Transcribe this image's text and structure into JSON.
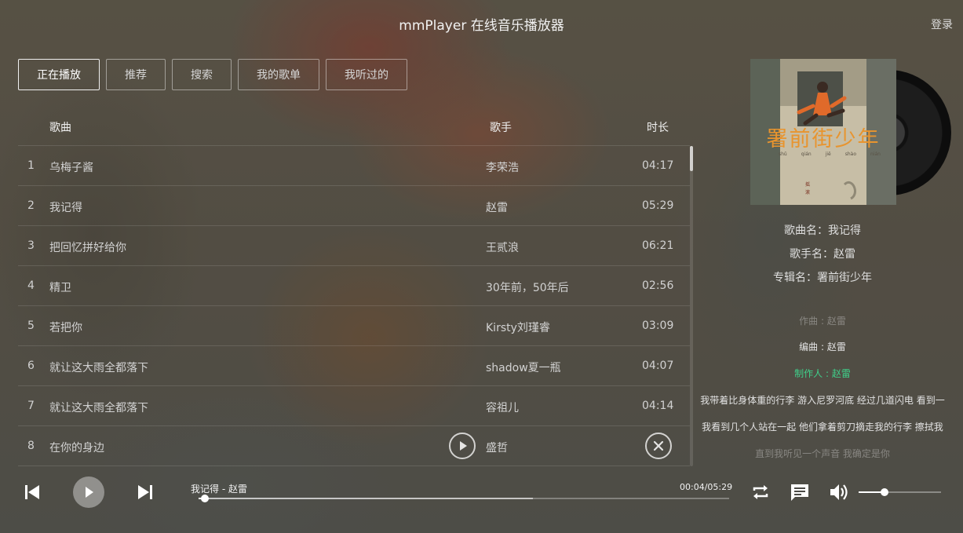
{
  "app": {
    "title": "mmPlayer 在线音乐播放器",
    "login_label": "登录"
  },
  "tabs": [
    {
      "label": "正在播放",
      "active": true
    },
    {
      "label": "推荐",
      "active": false
    },
    {
      "label": "搜索",
      "active": false
    },
    {
      "label": "我的歌单",
      "active": false
    },
    {
      "label": "我听过的",
      "active": false
    }
  ],
  "list": {
    "headers": {
      "song": "歌曲",
      "singer": "歌手",
      "duration": "时长"
    },
    "rows": [
      {
        "num": "1",
        "name": "乌梅子酱",
        "singer": "李荣浩",
        "duration": "04:17"
      },
      {
        "num": "2",
        "name": "我记得",
        "singer": "赵雷",
        "duration": "05:29"
      },
      {
        "num": "3",
        "name": "把回忆拼好给你",
        "singer": "王贰浪",
        "duration": "06:21"
      },
      {
        "num": "4",
        "name": "精卫",
        "singer": "30年前，50年后",
        "duration": "02:56"
      },
      {
        "num": "5",
        "name": "若把你",
        "singer": "Kirsty刘瑾睿",
        "duration": "03:09"
      },
      {
        "num": "6",
        "name": "就让这大雨全都落下",
        "singer": "shadow夏一瓶",
        "duration": "04:07"
      },
      {
        "num": "7",
        "name": "就让这大雨全都落下",
        "singer": "容祖儿",
        "duration": "04:14"
      },
      {
        "num": "8",
        "name": "在你的身边",
        "singer": "盛哲",
        "duration": ""
      }
    ],
    "hovered_row_index": 7
  },
  "album": {
    "cover_title_art": "署前街少年",
    "cover_pinyin": [
      "shǔ",
      "qián",
      "jiē",
      "shào",
      "nián"
    ]
  },
  "song_info": {
    "song_name": "歌曲名：我记得",
    "singer_name": "歌手名：赵雷",
    "album_name": "专辑名：署前街少年"
  },
  "lyrics": [
    {
      "text": "作曲 : 赵雷",
      "state": "dim"
    },
    {
      "text": "编曲 : 赵雷",
      "state": "normal"
    },
    {
      "text": "制作人 : 赵雷",
      "state": "current"
    },
    {
      "text": "我带着比身体重的行李 游入尼罗河底 经过几道闪电 看到一",
      "state": "normal"
    },
    {
      "text": "我看到几个人站在一起 他们拿着剪刀摘走我的行李 擦拭我",
      "state": "normal"
    },
    {
      "text": "直到我听见一个声音 我确定是你",
      "state": "dim"
    }
  ],
  "player": {
    "now_playing": "我记得 - 赵雷",
    "time": "00:04/05:29",
    "progress": 0.012,
    "buffered": 0.63,
    "volume": 0.31
  },
  "colors": {
    "lyric_current": "#3fd08a",
    "lyric_normal": "#e2e2e2",
    "lyric_dim": "rgba(225,225,225,0.38)",
    "text_primary": "#f2f2f2"
  },
  "icons": {
    "prev": "skip-previous-icon",
    "play": "play-icon",
    "next": "skip-next-icon",
    "loop": "repeat-icon",
    "lyric": "comment-icon",
    "volume": "volume-icon",
    "row_play": "play-circle-icon",
    "row_delete": "close-circle-icon"
  }
}
